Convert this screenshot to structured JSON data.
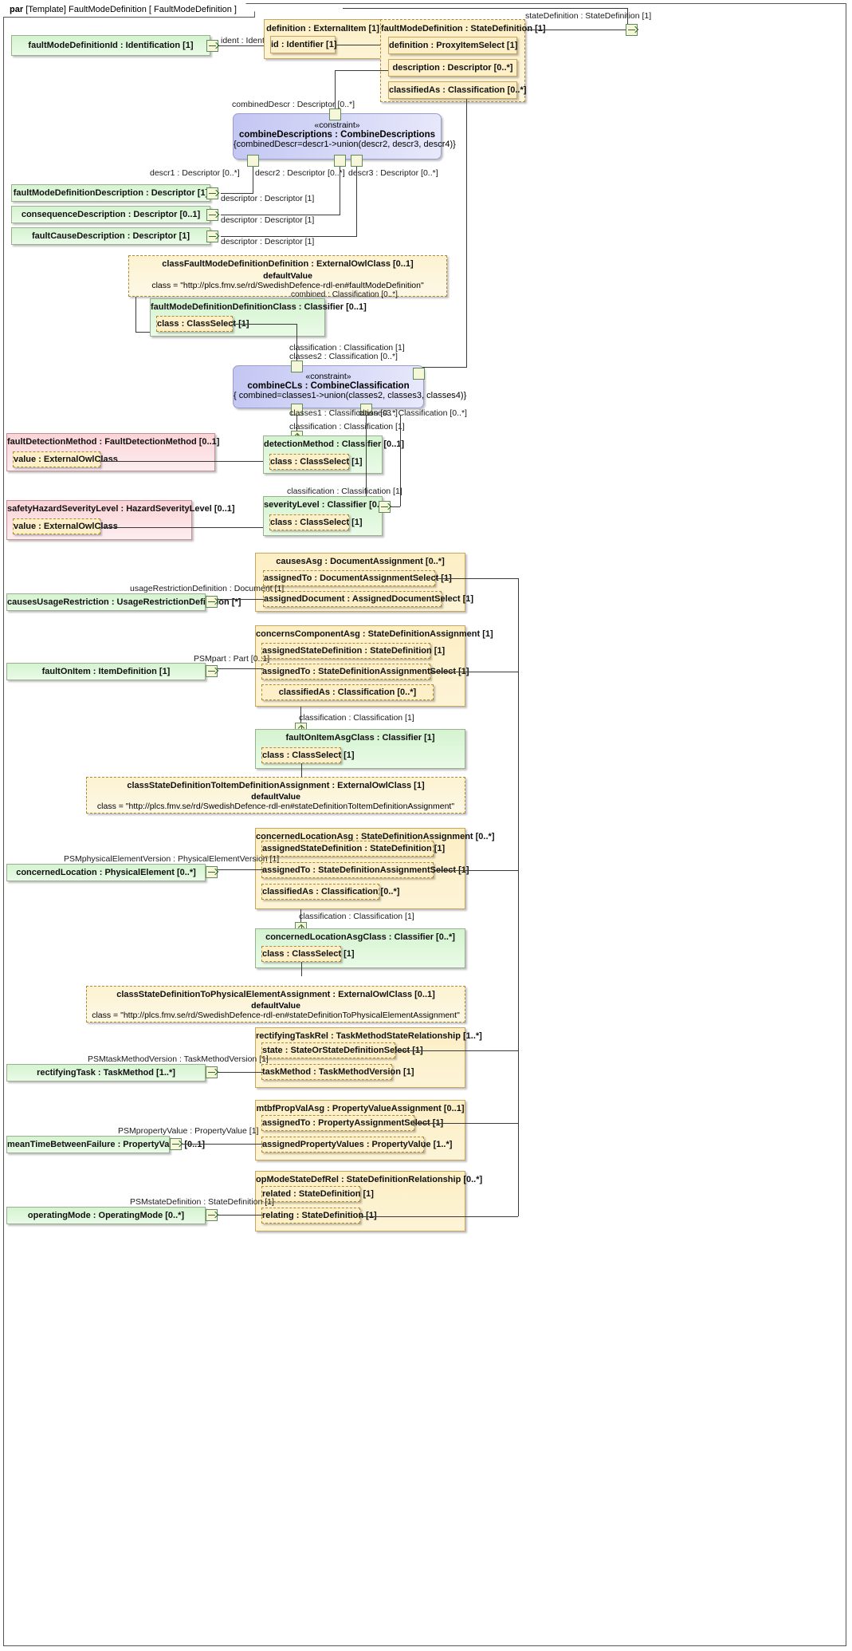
{
  "frame": {
    "keyword": "par",
    "stereotype": "[Template]",
    "name": "FaultModeDefinition",
    "param": "[ FaultModeDefinition ]"
  },
  "blocks": {
    "faultModeDefinitionId": "faultModeDefinitionId : Identification [1]",
    "definitionExternalItem": "definition : ExternalItem [1]",
    "idIdentifier": "id : Identifier [1]",
    "faultModeDefinition": "faultModeDefinition : StateDefinition [1]",
    "definitionProxyItemSelect": "definition : ProxyItemSelect [1]",
    "descriptionDescriptor": "description : Descriptor [0..*]",
    "classifiedAsClassification": "classifiedAs : Classification [0..*]",
    "faultModeDefinitionDescription": "faultModeDefinitionDescription : Descriptor [1]",
    "consequenceDescription": "consequenceDescription : Descriptor [0..1]",
    "faultCauseDescription": "faultCauseDescription : Descriptor [1]",
    "classFaultModeDefinitionDefinition": "classFaultModeDefinitionDefinition : ExternalOwlClass [0..1]",
    "faultModeDefinitionDefinitionClass": "faultModeDefinitionDefinitionClass : Classifier [0..1]",
    "classClassSelect1": "class : ClassSelect [1]",
    "faultDetectionMethod": "faultDetectionMethod : FaultDetectionMethod [0..1]",
    "valueExternalOwlClass1": "value : ExternalOwlClass",
    "detectionMethod": "detectionMethod : Classifier [0..1]",
    "classClassSelect2": "class : ClassSelect [1]",
    "safetyHazardSeverityLevel": "safetyHazardSeverityLevel : HazardSeverityLevel [0..1]",
    "valueExternalOwlClass2": "value : ExternalOwlClass",
    "severityLevel": "severityLevel : Classifier [0..1]",
    "classClassSelect3": "class : ClassSelect [1]",
    "causesAsg": "causesAsg : DocumentAssignment [0..*]",
    "assignedToDocumentAssignmentSelect": "assignedTo : DocumentAssignmentSelect [1]",
    "assignedDocument": "assignedDocument : AssignedDocumentSelect [1]",
    "causesUsageRestriction": "causesUsageRestriction : UsageRestrictionDefinition [*]",
    "concernsComponentAsg": "concernsComponentAsg : StateDefinitionAssignment [1]",
    "assignedStateDefinition1": "assignedStateDefinition : StateDefinition [1]",
    "assignedToStateDefSelect1": "assignedTo : StateDefinitionAssignmentSelect [1]",
    "classifiedAs1": "classifiedAs : Classification [0..*]",
    "faultOnItem": "faultOnItem : ItemDefinition [1]",
    "faultOnItemAsgClass": "faultOnItemAsgClass : Classifier [1]",
    "classClassSelect4": "class : ClassSelect [1]",
    "classStateDefinitionToItemDefinitionAssignment": "classStateDefinitionToItemDefinitionAssignment : ExternalOwlClass [1]",
    "concernedLocationAsg": "concernedLocationAsg : StateDefinitionAssignment [0..*]",
    "assignedStateDefinition2": "assignedStateDefinition : StateDefinition [1]",
    "assignedToStateDefSelect2": "assignedTo : StateDefinitionAssignmentSelect [1]",
    "classifiedAs2": "classifiedAs : Classification [0..*]",
    "concernedLocation": "concernedLocation : PhysicalElement [0..*]",
    "concernedLocationAsgClass": "concernedLocationAsgClass : Classifier [0..*]",
    "classClassSelect5": "class : ClassSelect [1]",
    "classStateDefinitionToPhysicalElementAssignment": "classStateDefinitionToPhysicalElementAssignment : ExternalOwlClass [0..1]",
    "rectifyingTaskRel": "rectifyingTaskRel : TaskMethodStateRelationship [1..*]",
    "stateOrStateDefinitionSelect": "state : StateOrStateDefinitionSelect [1]",
    "taskMethodTaskMethodVersion": "taskMethod : TaskMethodVersion [1]",
    "rectifyingTask": "rectifyingTask : TaskMethod [1..*]",
    "mtbfPropValAsg": "mtbfPropValAsg : PropertyValueAssignment [0..1]",
    "assignedToPropertyAssignmentSelect": "assignedTo : PropertyAssignmentSelect [1]",
    "assignedPropertyValues": "assignedPropertyValues : PropertyValue [1..*]",
    "meanTimeBetweenFailure": "meanTimeBetweenFailure : PropertyValue [0..1]",
    "opModeStateDefRel": "opModeStateDefRel : StateDefinitionRelationship [0..*]",
    "relatedStateDefinition": "related : StateDefinition [1]",
    "relatingStateDefinition": "relating : StateDefinition [1]",
    "operatingMode": "operatingMode : OperatingMode [0..*]"
  },
  "constraints": {
    "combineDescriptions": {
      "stereotype": "«constraint»",
      "name": "combineDescriptions : CombineDescriptions",
      "expression": "{combinedDescr=descr1->union(descr2, descr3, descr4)}"
    },
    "combineCLs": {
      "stereotype": "«constraint»",
      "name": "combineCLs : CombineClassification",
      "expression": "{ combined=classes1->union(classes2, classes3, classes4)}"
    }
  },
  "defaults": {
    "label": "defaultValue",
    "faultModeDefinitionClassUrl": "class = \"http://plcs.fmv.se/rd/SwedishDefence-rdl-en#faultModeDefinition\"",
    "stateDefinitionToItemDefinitionUrl": "class = \"http://plcs.fmv.se/rd/SwedishDefence-rdl-en#stateDefinitionToItemDefinitionAssignment\"",
    "stateDefinitionToPhysicalElementUrl": "class = \"http://plcs.fmv.se/rd/SwedishDefence-rdl-en#stateDefinitionToPhysicalElementAssignment\""
  },
  "edgeLabels": {
    "identIdentifier": "ident : Identifier",
    "stateDefinition": "stateDefinition : StateDefinition [1]",
    "combinedDescr": "combinedDescr : Descriptor [0..*]",
    "descr1": "descr1 : Descriptor [0..*]",
    "descr2": "descr2 : Descriptor [0..*]",
    "descr3": "descr3 : Descriptor [0..*]",
    "descriptor1": "descriptor : Descriptor [1]",
    "descriptor2": "descriptor : Descriptor [1]",
    "descriptor3": "descriptor : Descriptor [1]",
    "combinedClassification": "combined : Classification [0..*]",
    "classification1": "classification : Classification [1]",
    "classes2": "classes2 : Classification [0..*]",
    "classes1": "classes1 : Classification [0..*]",
    "classes3": "classes3 : Classification [0..*]",
    "classificationDetection": "classification : Classification [1]",
    "classificationSeverity": "classification : Classification [1]",
    "usageRestrictionDefinition": "usageRestrictionDefinition : Document [1]",
    "psmPart": "PSMpart : Part [0..1]",
    "classificationFaultOnItem": "classification : Classification [1]",
    "psmPhysicalElementVersion": "PSMphysicalElementVersion : PhysicalElementVersion [1]",
    "classificationConcernedLocation": "classification : Classification [1]",
    "psmTaskMethodVersion": "PSMtaskMethodVersion : TaskMethodVersion [1]",
    "psmPropertyValue": "PSMpropertyValue : PropertyValue [1]",
    "psmStateDefinition": "PSMstateDefinition : StateDefinition [1]"
  }
}
